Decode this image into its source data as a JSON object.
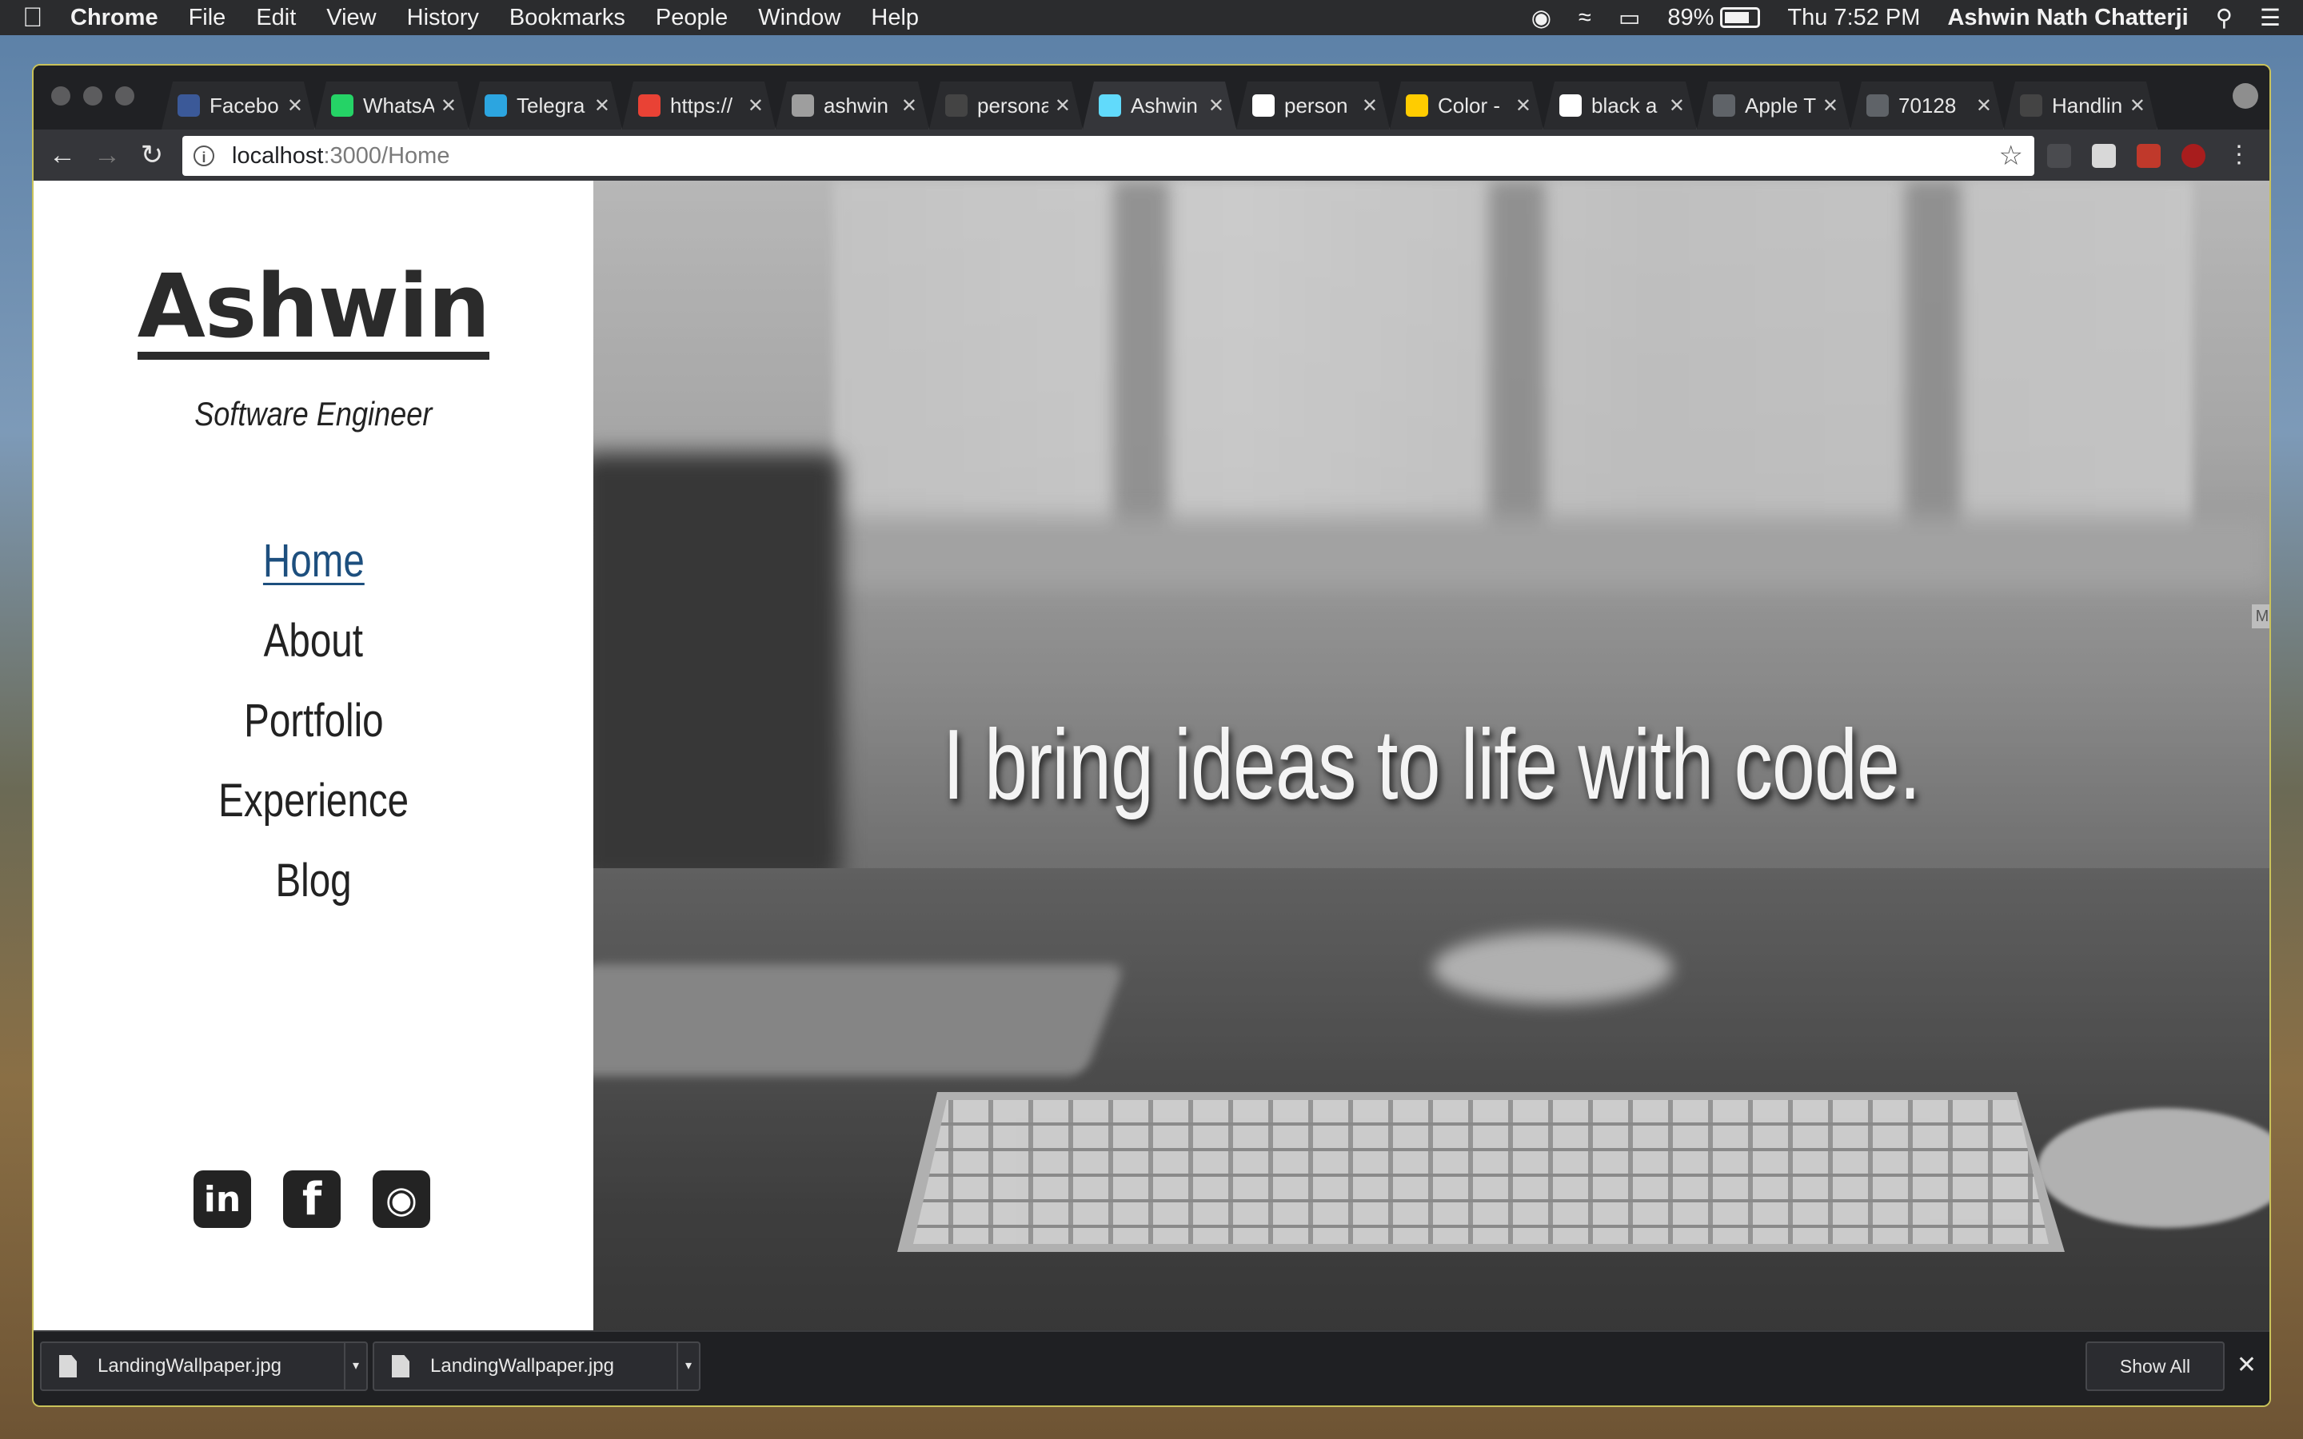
{
  "menubar": {
    "apple_icon": "apple-logo-icon",
    "items": [
      "Chrome",
      "File",
      "Edit",
      "View",
      "History",
      "Bookmarks",
      "People",
      "Window",
      "Help"
    ],
    "battery": "89%",
    "clock": "Thu 7:52 PM",
    "user": "Ashwin Nath Chatterji"
  },
  "browser": {
    "tabs": [
      {
        "label": "Facebo",
        "icon": "facebook-icon",
        "color": "#3b5998"
      },
      {
        "label": "WhatsA",
        "icon": "whatsapp-icon",
        "color": "#25d366"
      },
      {
        "label": "Telegra",
        "icon": "telegram-icon",
        "color": "#2ca5e0"
      },
      {
        "label": "https://",
        "icon": "calendar-icon",
        "color": "#e94235"
      },
      {
        "label": "ashwin",
        "icon": "generic-site-icon",
        "color": "#9e9e9e"
      },
      {
        "label": "persona",
        "icon": "github-icon",
        "color": "#444444"
      },
      {
        "label": "Ashwin",
        "icon": "react-icon",
        "color": "#61dafb"
      },
      {
        "label": "person",
        "icon": "google-icon",
        "color": "#ffffff"
      },
      {
        "label": "Color -",
        "icon": "flag-icon",
        "color": "#ffcc00"
      },
      {
        "label": "black a",
        "icon": "google-icon",
        "color": "#ffffff"
      },
      {
        "label": "Apple T",
        "icon": "document-icon",
        "color": "#5f6368"
      },
      {
        "label": "70128",
        "icon": "document-icon",
        "color": "#5f6368"
      },
      {
        "label": "Handlin",
        "icon": "github-icon",
        "color": "#444444"
      }
    ],
    "url_host": "localhost",
    "url_path": ":3000/Home"
  },
  "site": {
    "brand": "Ashwin",
    "subtitle": "Software Engineer",
    "nav": [
      "Home",
      "About",
      "Portfolio",
      "Experience",
      "Blog"
    ],
    "active_nav": "Home",
    "social": [
      {
        "name": "linkedin-icon",
        "glyph": "in"
      },
      {
        "name": "facebook-icon",
        "glyph": "f"
      },
      {
        "name": "github-icon",
        "glyph": "◉"
      }
    ],
    "tagline": "I bring ideas to life with code."
  },
  "downloads": {
    "items": [
      "LandingWallpaper.jpg",
      "LandingWallpaper.jpg"
    ],
    "show_all": "Show All"
  },
  "colors": {
    "nav_active": "#1d4f7e",
    "window_border": "#c9c25a"
  }
}
